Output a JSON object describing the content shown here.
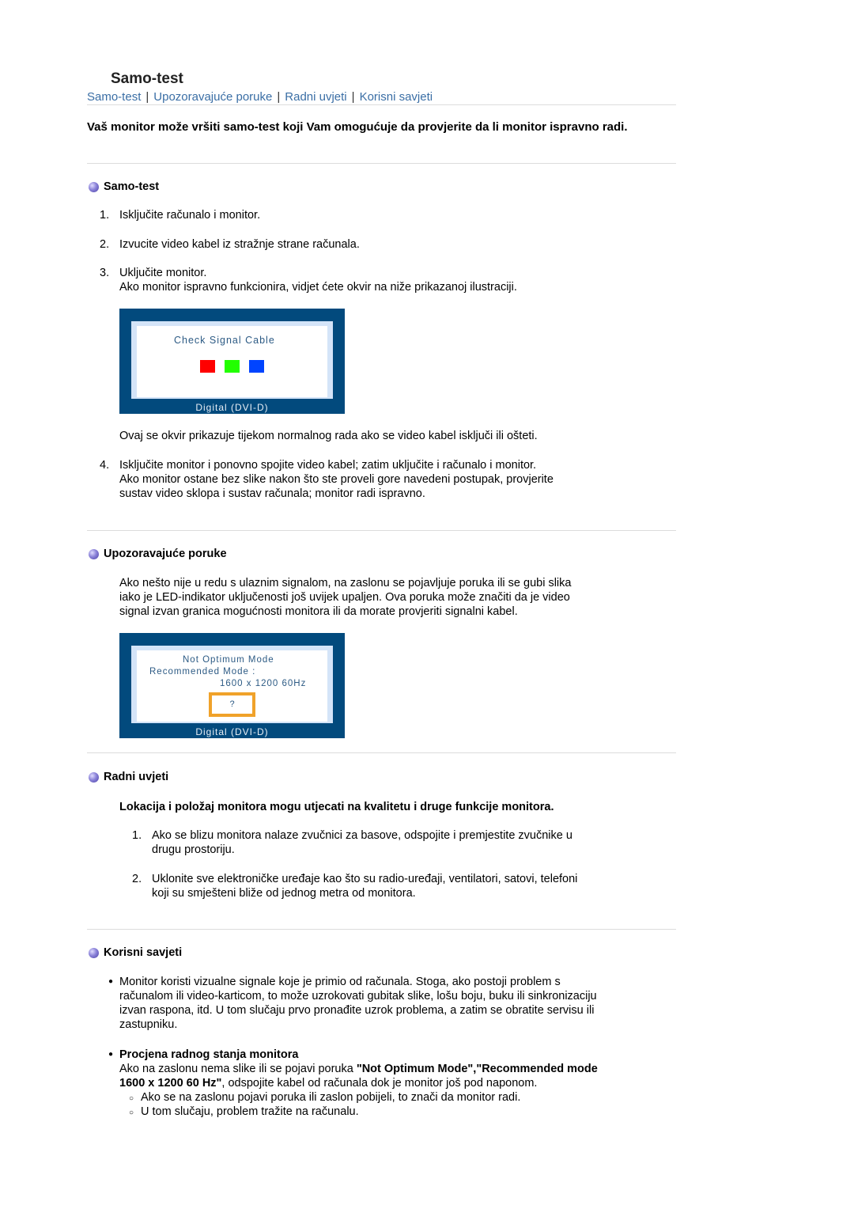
{
  "title": "Samo-test",
  "nav": [
    "Samo-test",
    "Upozoravajuće poruke",
    "Radni uvjeti",
    "Korisni savjeti"
  ],
  "intro": "Vaš monitor može vršiti samo-test koji Vam omogućuje da provjerite da li monitor ispravno radi.",
  "sections": {
    "selftest": {
      "heading": "Samo-test",
      "steps": [
        {
          "num": "1.",
          "text": "Isključite računalo i monitor."
        },
        {
          "num": "2.",
          "text": "Izvucite video kabel iz stražnje strane računala."
        },
        {
          "num": "3.",
          "text": "Uključite monitor.",
          "extra": "Ako monitor ispravno funkcionira, vidjet ćete okvir na niže prikazanoj ilustraciji."
        }
      ],
      "illustration": {
        "message": "Check Signal Cable",
        "footer": "Digital (DVI-D)",
        "colors": [
          "#ff0000",
          "#22ff00",
          "#0044ff"
        ]
      },
      "caption": "Ovaj se okvir prikazuje tijekom normalnog rada ako se video kabel isključi ili ošteti.",
      "step4": {
        "num": "4.",
        "lines": [
          "Isključite monitor i ponovno spojite video kabel; zatim uključite i računalo i monitor.",
          "Ako monitor ostane bez slike nakon što ste proveli gore navedeni postupak, provjerite",
          "sustav video sklopa i sustav računala; monitor radi ispravno."
        ]
      }
    },
    "warnings": {
      "heading": "Upozoravajuće poruke",
      "lines": [
        "Ako nešto nije u redu s ulaznim signalom, na zaslonu se pojavljuje poruka ili se gubi slika",
        "iako je LED-indikator uključenosti još uvijek upaljen. Ova poruka može značiti da je video",
        "signal izvan granica mogućnosti monitora ili da morate provjeriti signalni kabel."
      ],
      "illustration": {
        "line1": "Not Optimum Mode",
        "line2": "Recommended Mode :",
        "line3": "1600 x 1200 60Hz",
        "box": "?",
        "footer": "Digital (DVI-D)"
      }
    },
    "conditions": {
      "heading": "Radni uvjeti",
      "bold_line": "Lokacija i položaj monitora mogu utjecati na kvalitetu i druge funkcije monitora.",
      "items": [
        {
          "num": "1.",
          "lines": [
            "Ako se blizu monitora nalaze zvučnici za basove, odspojite i premjestite zvučnike u",
            "drugu prostoriju."
          ]
        },
        {
          "num": "2.",
          "lines": [
            "Uklonite sve elektroničke uređaje kao što su radio-uređaji, ventilatori, satovi, telefoni",
            "koji su smješteni bliže od jednog metra od monitora."
          ]
        }
      ]
    },
    "tips": {
      "heading": "Korisni savjeti",
      "bullet1": [
        "Monitor koristi vizualne signale koje je primio od računala. Stoga, ako postoji problem s",
        "računalom ili video-karticom, to može uzrokovati gubitak slike, lošu boju, buku ili sinkronizaciju",
        "izvan raspona, itd. U tom slučaju prvo pronađite uzrok problema, a zatim se obratite servisu ili",
        "zastupniku."
      ],
      "bullet2": {
        "title": "Procjena radnog stanja monitora",
        "line1_pre": "Ako na zaslonu nema slike ili se pojavi poruka ",
        "line1_bold": "\"Not Optimum Mode\",\"Recommended mode",
        "line2_bold": "1600 x 1200 60 Hz\"",
        "line2_post": ", odspojite kabel od računala dok je monitor još pod naponom.",
        "sub": [
          "Ako se na zaslonu pojavi poruka ili zaslon pobijeli, to znači da monitor radi.",
          "U tom slučaju, problem tražite na računalu."
        ]
      }
    }
  }
}
